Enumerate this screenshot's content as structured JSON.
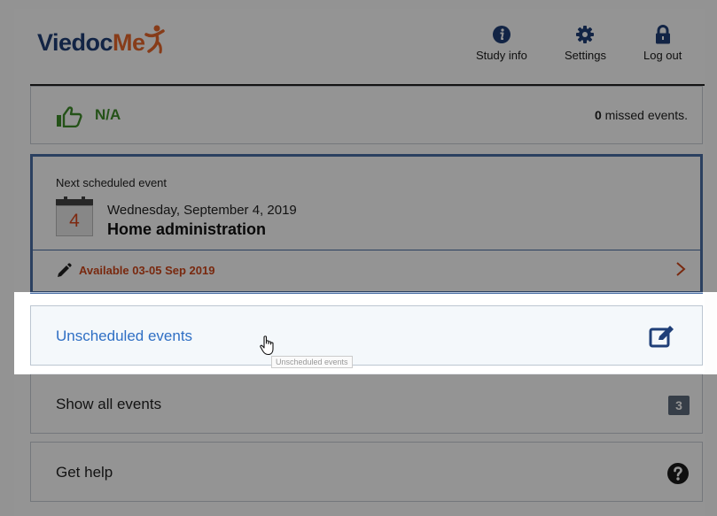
{
  "header": {
    "logo": {
      "part1": "Viedoc",
      "part2": "Me"
    },
    "nav": [
      {
        "label": "Study info",
        "icon": "info-circle-icon"
      },
      {
        "label": "Settings",
        "icon": "gear-icon"
      },
      {
        "label": "Log out",
        "icon": "lock-icon"
      }
    ]
  },
  "status": {
    "compliance": "N/A",
    "missed_count": "0",
    "missed_text": "missed events."
  },
  "next_event": {
    "label": "Next scheduled event",
    "day": "4",
    "date": "Wednesday, September 4, 2019",
    "title": "Home administration",
    "availability": "Available 03-05 Sep 2019"
  },
  "rows": {
    "unscheduled": "Unscheduled events",
    "all_events": "Show all events",
    "all_events_count": "3",
    "help": "Get help"
  },
  "tooltip": "Unscheduled events",
  "colors": {
    "brand_blue": "#1f3f78",
    "brand_orange": "#e8682c",
    "accent_green": "#3e8e2a",
    "accent_orange": "#d0471b",
    "link_blue": "#2f6fc4",
    "border_blue": "#4a6fa5"
  }
}
